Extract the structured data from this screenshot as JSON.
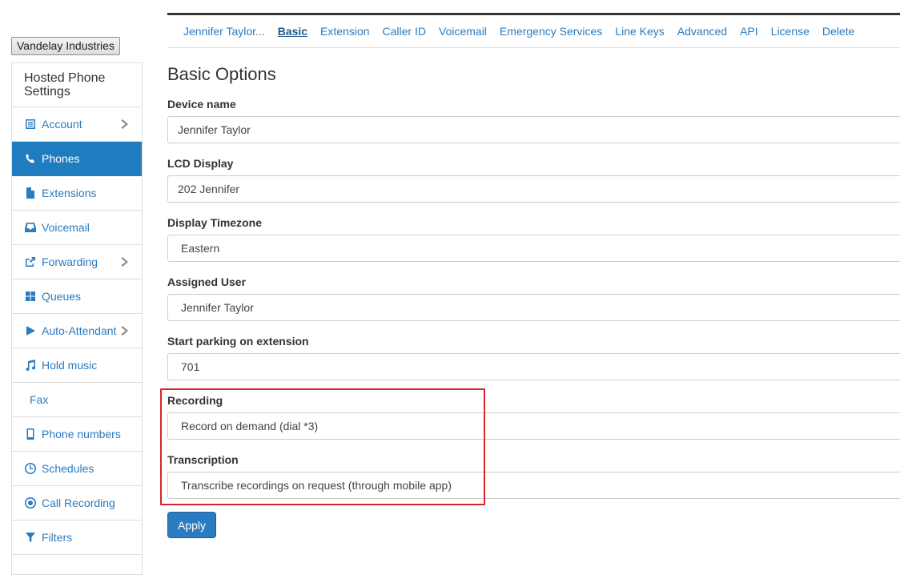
{
  "company": {
    "label": "Vandelay Industries"
  },
  "sidebar": {
    "title": "Hosted Phone Settings",
    "items": [
      {
        "label": "Account",
        "icon": "list-icon",
        "active": false,
        "has_submenu": true
      },
      {
        "label": "Phones",
        "icon": "phone-icon",
        "active": true,
        "has_submenu": false
      },
      {
        "label": "Extensions",
        "icon": "file-icon",
        "active": false,
        "has_submenu": false
      },
      {
        "label": "Voicemail",
        "icon": "inbox-icon",
        "active": false,
        "has_submenu": false
      },
      {
        "label": "Forwarding",
        "icon": "share-icon",
        "active": false,
        "has_submenu": true
      },
      {
        "label": "Queues",
        "icon": "grid-icon",
        "active": false,
        "has_submenu": false
      },
      {
        "label": "Auto-Attendant",
        "icon": "play-icon",
        "active": false,
        "has_submenu": true
      },
      {
        "label": "Hold music",
        "icon": "music-icon",
        "active": false,
        "has_submenu": false
      },
      {
        "label": "Fax",
        "icon": "",
        "active": false,
        "has_submenu": false
      },
      {
        "label": "Phone numbers",
        "icon": "mobile-icon",
        "active": false,
        "has_submenu": false
      },
      {
        "label": "Schedules",
        "icon": "clock-icon",
        "active": false,
        "has_submenu": false
      },
      {
        "label": "Call Recording",
        "icon": "record-icon",
        "active": false,
        "has_submenu": false
      },
      {
        "label": "Filters",
        "icon": "filter-icon",
        "active": false,
        "has_submenu": false
      }
    ]
  },
  "topnav": {
    "tabs": [
      {
        "label": "Jennifer Taylor...",
        "active": false
      },
      {
        "label": "Basic",
        "active": true
      },
      {
        "label": "Extension",
        "active": false
      },
      {
        "label": "Caller ID",
        "active": false
      },
      {
        "label": "Voicemail",
        "active": false
      },
      {
        "label": "Emergency Services",
        "active": false
      },
      {
        "label": "Line Keys",
        "active": false
      },
      {
        "label": "Advanced",
        "active": false
      },
      {
        "label": "API",
        "active": false
      },
      {
        "label": "License",
        "active": false
      },
      {
        "label": "Delete",
        "active": false
      }
    ]
  },
  "main": {
    "title": "Basic Options",
    "fields": {
      "device_name": {
        "label": "Device name",
        "value": "Jennifer Taylor"
      },
      "lcd_display": {
        "label": "LCD Display",
        "value": "202 Jennifer"
      },
      "display_timezone": {
        "label": "Display Timezone",
        "value": "Eastern"
      },
      "assigned_user": {
        "label": "Assigned User",
        "value": "Jennifer Taylor"
      },
      "start_parking": {
        "label": "Start parking on extension",
        "value": "701"
      },
      "recording": {
        "label": "Recording",
        "value": "Record on demand (dial *3)"
      },
      "transcription": {
        "label": "Transcription",
        "value": "Transcribe recordings on request (through mobile app)"
      }
    },
    "apply_label": "Apply"
  },
  "colors": {
    "accent": "#2a7bbf",
    "active_bg": "#1f7cbf",
    "highlight": "#d9262b"
  }
}
